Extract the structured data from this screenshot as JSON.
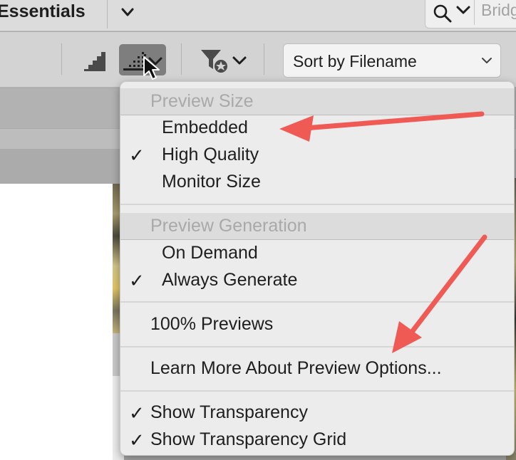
{
  "header": {
    "workspace_label": "Essentials",
    "search_placeholder": "Bridg",
    "icons": [
      "chevron-down-icon",
      "search-icon"
    ]
  },
  "toolbar": {
    "sort_label": "Sort by Filename",
    "icons": [
      "quality-fast-icon",
      "quality-high-icon",
      "filter-icon",
      "chevron-down-icon"
    ]
  },
  "menu": {
    "preview_size_header": "Preview Size",
    "embedded": "Embedded",
    "high_quality": "High Quality",
    "monitor_size": "Monitor Size",
    "preview_generation_header": "Preview Generation",
    "on_demand": "On Demand",
    "always_generate": "Always Generate",
    "previews_100": "100% Previews",
    "learn_more": "Learn More About Preview Options...",
    "show_transparency": "Show Transparency",
    "show_transparency_grid": "Show Transparency Grid",
    "checkmark": "✓"
  },
  "colors": {
    "accent_arrow": "#f05a55",
    "menu_bg": "#ececec",
    "header_text": "#a9a9a9"
  }
}
